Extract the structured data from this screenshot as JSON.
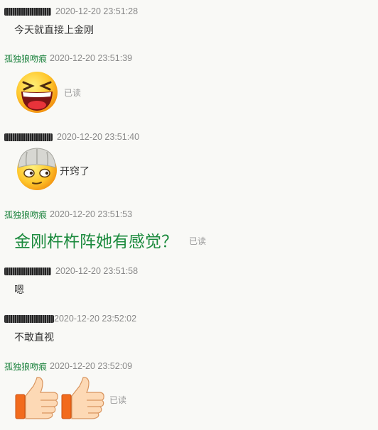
{
  "messages": [
    {
      "sender": "",
      "sender_type": "redacted",
      "time": "2020-12-20 23:51:28",
      "content": "今天就直接上金刚"
    },
    {
      "sender": "孤独狼吻痕",
      "sender_type": "self",
      "time": "2020-12-20 23:51:39",
      "content_icon": "laughing-emoji-icon",
      "read_status": "已读"
    },
    {
      "sender": "",
      "sender_type": "redacted",
      "time": "2020-12-20 23:51:40",
      "content_icon": "enlightened-emoji-icon",
      "content": "开窍了"
    },
    {
      "sender": "孤独狼吻痕",
      "sender_type": "self",
      "time": "2020-12-20 23:51:53",
      "content": "金刚杵杵阵她有感觉？",
      "read_status": "已读"
    },
    {
      "sender": "",
      "sender_type": "redacted",
      "time": "2020-12-20 23:51:58",
      "content": "嗯"
    },
    {
      "sender": "",
      "sender_type": "redacted",
      "time": "2020-12-20 23:52:02",
      "content": "不敢直视"
    },
    {
      "sender": "孤独狼吻痕",
      "sender_type": "self",
      "time": "2020-12-20 23:52:09",
      "content_icon": "thumbs-up-emoji-icon",
      "read_status": "已读"
    }
  ],
  "colors": {
    "background": "#f9f9f6",
    "self_name": "#19813b",
    "timestamp": "#888888",
    "read_status": "#999999"
  }
}
